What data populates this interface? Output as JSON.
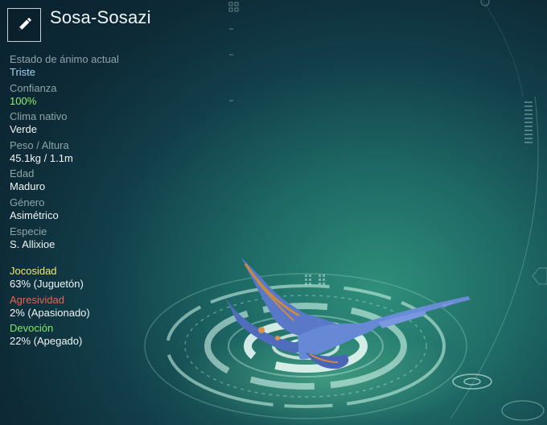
{
  "creature": {
    "name": "Sosa-Sosazi",
    "edit_icon": "pencil-icon"
  },
  "stats": [
    {
      "label": "Estado de ánimo actual",
      "value": "Triste"
    },
    {
      "label": "Confianza",
      "value": "100%"
    },
    {
      "label": "Clima nativo",
      "value": "Verde"
    },
    {
      "label": "Peso / Altura",
      "value": "45.1kg / 1.1m"
    },
    {
      "label": "Edad",
      "value": "Maduro"
    },
    {
      "label": "Género",
      "value": "Asimétrico"
    },
    {
      "label": "Especie",
      "value": "S. Allixioe"
    }
  ],
  "traits": [
    {
      "label": "Jocosidad",
      "value": "63% (Juguetón)",
      "color": "#f4e778"
    },
    {
      "label": "Agresividad",
      "value": "2% (Apasionado)",
      "color": "#e6644f"
    },
    {
      "label": "Devoción",
      "value": "22% (Apegado)",
      "color": "#7ee86c"
    }
  ],
  "colors": {
    "mood_value": "#a8d2f0",
    "trust_value": "#8ef06a",
    "creature_body": "#5b7fd0",
    "creature_accent": "#c98a44"
  }
}
